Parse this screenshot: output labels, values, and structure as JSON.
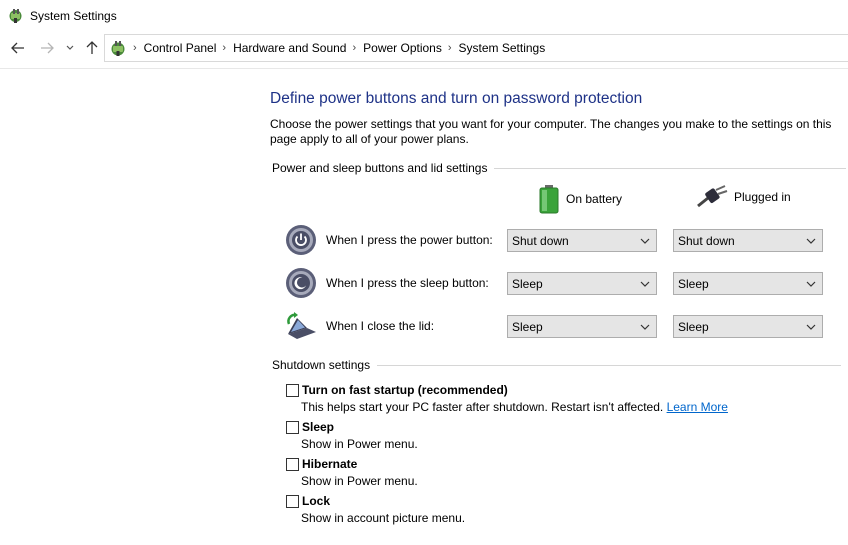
{
  "window": {
    "title": "System Settings"
  },
  "address": {
    "breadcrumbs": [
      "Control Panel",
      "Hardware and Sound",
      "Power Options",
      "System Settings"
    ]
  },
  "page": {
    "title": "Define power buttons and turn on password protection",
    "description": "Choose the power settings that you want for your computer. The changes you make to the settings on this page apply to all of your power plans."
  },
  "buttons_group": {
    "heading": "Power and sleep buttons and lid settings",
    "columns": {
      "battery": "On battery",
      "plugged": "Plugged in"
    },
    "rows": [
      {
        "label": "When I press the power button:",
        "battery": "Shut down",
        "plugged": "Shut down"
      },
      {
        "label": "When I press the sleep button:",
        "battery": "Sleep",
        "plugged": "Sleep"
      },
      {
        "label": "When I close the lid:",
        "battery": "Sleep",
        "plugged": "Sleep"
      }
    ]
  },
  "shutdown_group": {
    "heading": "Shutdown settings",
    "options": [
      {
        "label": "Turn on fast startup (recommended)",
        "desc": "This helps start your PC faster after shutdown. Restart isn't affected.",
        "link": "Learn More",
        "checked": false
      },
      {
        "label": "Sleep",
        "desc": "Show in Power menu.",
        "checked": false
      },
      {
        "label": "Hibernate",
        "desc": "Show in Power menu.",
        "checked": false
      },
      {
        "label": "Lock",
        "desc": "Show in account picture menu.",
        "checked": false
      }
    ]
  },
  "colors": {
    "title_blue": "#1e3287",
    "link_blue": "#0066cc",
    "select_bg": "#e5e5e5"
  }
}
